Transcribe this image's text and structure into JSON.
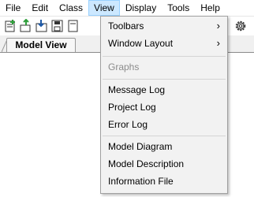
{
  "menubar": {
    "items": [
      {
        "label": "File"
      },
      {
        "label": "Edit"
      },
      {
        "label": "Class"
      },
      {
        "label": "View"
      },
      {
        "label": "Display"
      },
      {
        "label": "Tools"
      },
      {
        "label": "Help"
      }
    ],
    "active": "View"
  },
  "toolbar": {
    "icons": [
      "new-file-icon",
      "add-class-icon",
      "import-icon",
      "save-icon",
      "document-icon",
      "settings-gear-icon"
    ]
  },
  "tabs": [
    {
      "label": "Model View"
    }
  ],
  "view_menu": {
    "items": [
      {
        "label": "Toolbars",
        "submenu_arrow": "›"
      },
      {
        "label": "Window Layout",
        "submenu_arrow": "›"
      },
      {
        "label": "Graphs"
      },
      {
        "label": "Message Log"
      },
      {
        "label": "Project Log"
      },
      {
        "label": "Error Log"
      },
      {
        "label": "Model Diagram"
      },
      {
        "label": "Model Description"
      },
      {
        "label": "Information File"
      }
    ]
  },
  "colors": {
    "menu_highlight": "#cce8ff",
    "menu_highlight_border": "#99d1ff",
    "icon_green": "#2e9e3a",
    "icon_blue": "#1e5aa8"
  }
}
